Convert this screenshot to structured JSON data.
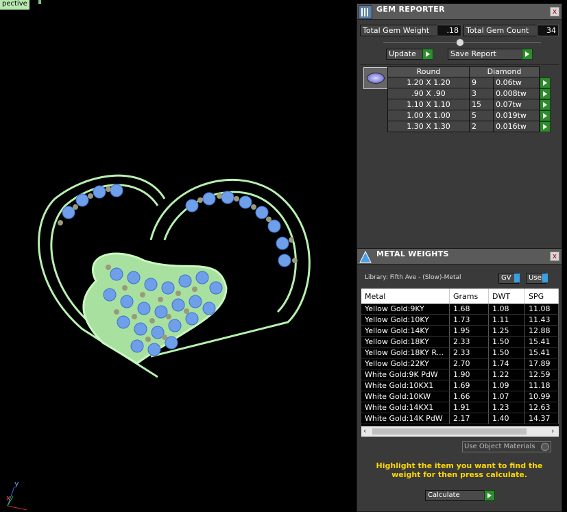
{
  "viewport": {
    "label": "pective"
  },
  "gem_reporter": {
    "title": "GEM REPORTER",
    "close_label": "x",
    "total_weight_label": "Total Gem Weight",
    "total_weight_value": ".18",
    "total_count_label": "Total Gem Count",
    "total_count_value": "34",
    "update_label": "Update",
    "save_report_label": "Save Report",
    "table": {
      "col_shape": "Round",
      "col_type": "Diamond",
      "rows": [
        {
          "size": "1.20 X 1.20",
          "count": "9",
          "weight": "0.06tw"
        },
        {
          "size": ".90 X .90",
          "count": "3",
          "weight": "0.008tw"
        },
        {
          "size": "1.10 X 1.10",
          "count": "15",
          "weight": "0.07tw"
        },
        {
          "size": "1.00 X 1.00",
          "count": "5",
          "weight": "0.019tw"
        },
        {
          "size": "1.30 X 1.30",
          "count": "2",
          "weight": "0.016tw"
        }
      ]
    }
  },
  "metal_weights": {
    "title": "METAL WEIGHTS",
    "close_label": "x",
    "library": "Library: Fifth Ave - (Slow)-Metal",
    "gv_label": "GV",
    "user_label": "User",
    "columns": [
      "Metal",
      "Grams",
      "DWT",
      "SPG"
    ],
    "rows": [
      [
        "Yellow Gold:9KY",
        "1.68",
        "1.08",
        "11.08"
      ],
      [
        "Yellow Gold:10KY",
        "1.73",
        "1.11",
        "11.43"
      ],
      [
        "Yellow Gold:14KY",
        "1.95",
        "1.25",
        "12.88"
      ],
      [
        "Yellow Gold:18KY",
        "2.33",
        "1.50",
        "15.41"
      ],
      [
        "Yellow Gold:18KY R...",
        "2.33",
        "1.50",
        "15.41"
      ],
      [
        "Yellow Gold:22KY",
        "2.70",
        "1.74",
        "17.89"
      ],
      [
        "White Gold:9K PdW",
        "1.90",
        "1.22",
        "12.59"
      ],
      [
        "White Gold:10KX1",
        "1.69",
        "1.09",
        "11.18"
      ],
      [
        "White Gold:10KW",
        "1.66",
        "1.07",
        "10.99"
      ],
      [
        "White Gold:14KX1",
        "1.91",
        "1.23",
        "12.63"
      ],
      [
        "White Gold:14K PdW",
        "2.17",
        "1.40",
        "14.37"
      ]
    ],
    "use_object_materials": "Use Object Materials",
    "hint": "Highlight the item you want to find the weight for then press calculate.",
    "calculate_label": "Calculate"
  },
  "axes": {
    "y": "y",
    "x": "x"
  }
}
